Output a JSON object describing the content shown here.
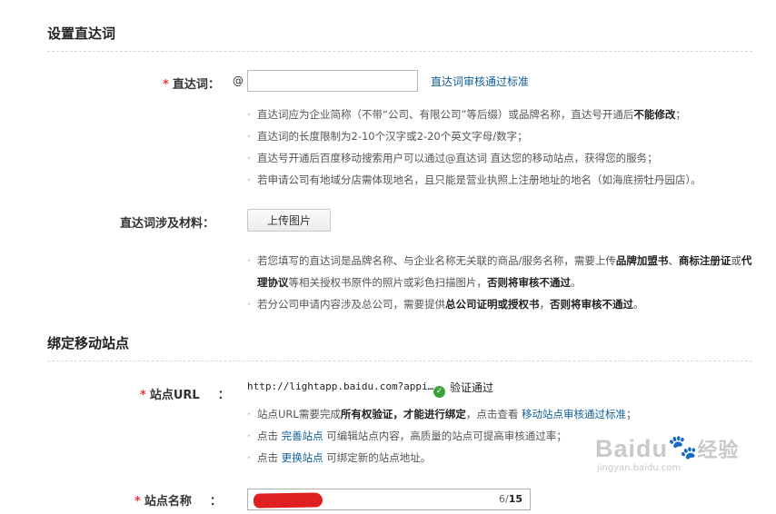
{
  "section1": {
    "title": "设置直达词"
  },
  "keyword_field": {
    "label": "直达词：",
    "at_sign": "@",
    "value": "",
    "link": "直达词审核通过标准",
    "notes": [
      [
        "直达词应为企业简称（不带“公司、有限公司”等后缀）或品牌名称，直达号开通后",
        "不能修改",
        "；"
      ],
      [
        "直达词的长度限制为2-10个汉字或2-20个英文字母/数字；"
      ],
      [
        "直达号开通后百度移动搜索用户可以通过@直达词 直达您的移动站点，获得您的服务；"
      ],
      [
        "若申请公司有地域分店需体现地名，且只能是营业执照上注册地址的地名（如海底捞牡丹园店）。"
      ]
    ]
  },
  "material_field": {
    "label": "直达词涉及材料：",
    "button": "上传图片",
    "note1_parts": [
      "若您填写的直达词是品牌名称、与企业名称无关联的商品/服务名称，需要上传",
      "品牌加盟书",
      "、",
      "商标注册证",
      "或",
      "代理协议",
      "等相关授权书原件的照片或彩色扫描图片，",
      "否则将审核不通过",
      "。"
    ],
    "note2_parts": [
      "若分公司申请内容涉及总公司，需要提供",
      "总公司证明或授权书",
      "，",
      "否则将审核不通过",
      "。"
    ]
  },
  "section2": {
    "title": "绑定移动站点"
  },
  "url_field": {
    "label": "站点URL",
    "colon": "：",
    "value": "http://lightapp.baidu.com?appi…",
    "status": "验证通过",
    "note1_parts": [
      "站点URL需要完成",
      "所有权验证，才能进行绑定",
      "，点击查看 ",
      "移动站点审核通过标准",
      "；"
    ],
    "note2_parts": [
      "点击 ",
      "完善站点",
      " 可编辑站点内容，高质量的站点可提高审核通过率；"
    ],
    "note3_parts": [
      "点击 ",
      "更换站点",
      " 可绑定新的站点地址。"
    ]
  },
  "name_field": {
    "label": "站点名称",
    "colon": "：",
    "count": "6",
    "max": "15"
  },
  "watermark": {
    "main": "Baidu",
    "paw": "🐾",
    "cn": "经验",
    "sub": "jingyan.baidu.com"
  }
}
